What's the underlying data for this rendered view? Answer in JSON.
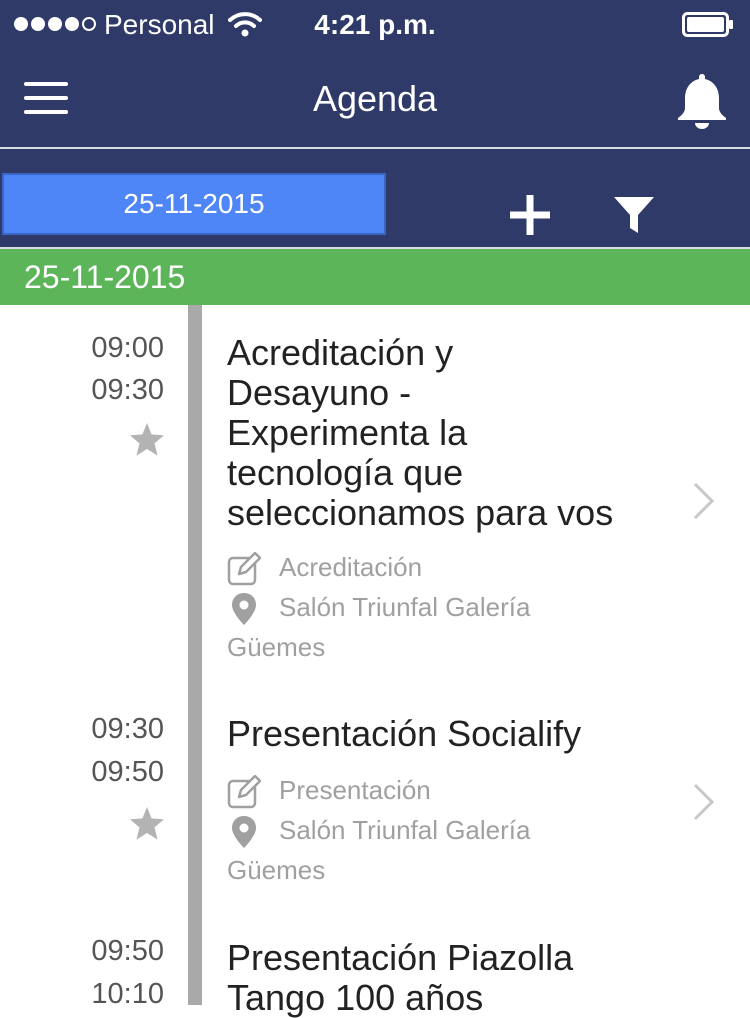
{
  "status_bar": {
    "carrier": "Personal",
    "time": "4:21 p.m.",
    "signal_bars_filled": 4,
    "signal_bars_total": 5
  },
  "nav": {
    "title": "Agenda",
    "menu_icon": "hamburger-menu-icon",
    "notifications_icon": "bell-icon"
  },
  "toolbar": {
    "date_value": "25-11-2015",
    "add_icon": "plus-icon",
    "filter_icon": "filter-icon"
  },
  "day_header": "25-11-2015",
  "colors": {
    "nav_bg": "#2f3a68",
    "date_field": "#4f86f7",
    "day_header": "#5db55a",
    "timeline": "#a9a9a9"
  },
  "events": [
    {
      "start": "09:00",
      "end": "09:30",
      "title_lines": [
        "Acreditación y",
        "Desayuno -",
        "Experimenta la",
        "tecnología que",
        "seleccionamos para vos"
      ],
      "category": "Acreditación",
      "location_line1": "Salón Triunfal Galería",
      "location_line2": "Güemes"
    },
    {
      "start": "09:30",
      "end": "09:50",
      "title_lines": [
        "Presentación Socialify"
      ],
      "category": "Presentación",
      "location_line1": "Salón Triunfal Galería",
      "location_line2": "Güemes"
    },
    {
      "start": "09:50",
      "end": "10:10",
      "title_lines": [
        "Presentación Piazolla",
        "Tango 100 años"
      ]
    }
  ]
}
